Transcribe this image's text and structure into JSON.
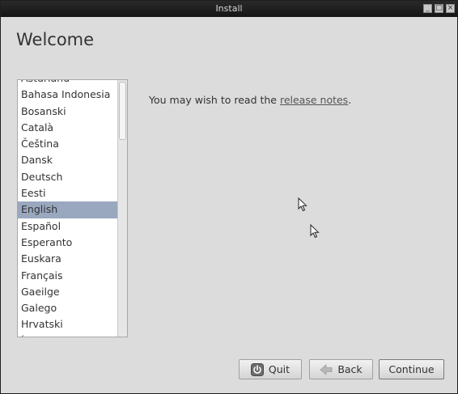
{
  "window": {
    "title": "Install",
    "controls": [
      "_",
      "□",
      "×"
    ]
  },
  "page_title": "Welcome",
  "languages": [
    "Asturianu",
    "Bahasa Indonesia",
    "Bosanski",
    "Català",
    "Čeština",
    "Dansk",
    "Deutsch",
    "Eesti",
    "English",
    "Español",
    "Esperanto",
    "Euskara",
    "Français",
    "Gaeilge",
    "Galego",
    "Hrvatski",
    "Íslenska"
  ],
  "selected_language": "English",
  "release": {
    "prefix": "You may wish to read the ",
    "link": "release notes",
    "suffix": "."
  },
  "buttons": {
    "quit": "Quit",
    "back": "Back",
    "continue": "Continue"
  },
  "icons": {
    "quit": "power-icon",
    "back": "back-arrow-icon",
    "cursor": "mouse-pointer-icon"
  }
}
